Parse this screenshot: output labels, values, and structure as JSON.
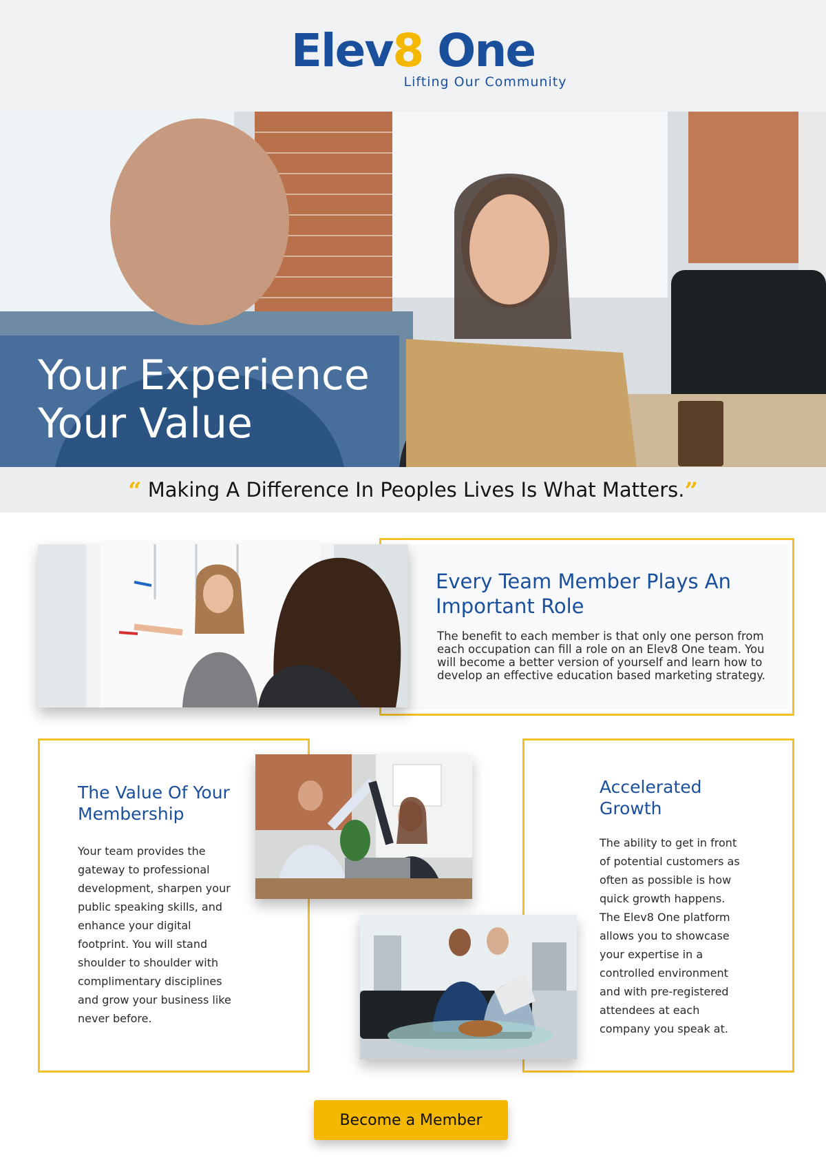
{
  "brand": {
    "name_part1": "Elev",
    "name_eight": "8",
    "name_part2": " One",
    "tagline": "Lifting Our Community",
    "primary_color": "#1a4f9c",
    "accent_color": "#f5b800"
  },
  "hero": {
    "title_line1": "Your Experience",
    "title_line2": "Your Value"
  },
  "quote": {
    "open_mark": "“",
    "text": "Making A Difference In Peoples Lives Is What Matters.",
    "close_mark": "”"
  },
  "team_role": {
    "title": "Every Team Member Plays An Important Role",
    "body": "The benefit to each member is that only one person from each occupation can fill a role on an Elev8 One team. You will become a better version of yourself and learn how to develop an effective education based marketing strategy."
  },
  "membership": {
    "title": "The Value Of Your Membership",
    "body": "Your team provides the gateway to professional development, sharpen your public speaking skills, and enhance your digital footprint. You will stand shoulder to shoulder with complimentary disciplines and grow your business like never before."
  },
  "growth": {
    "title": "Accelerated Growth",
    "body": "The ability to get in front of potential customers as often as possible is how quick growth happens. The Elev8 One platform allows you to showcase your expertise in a controlled environment and with pre-registered attendees at each company you speak at."
  },
  "cta": {
    "label": "Become a Member"
  }
}
